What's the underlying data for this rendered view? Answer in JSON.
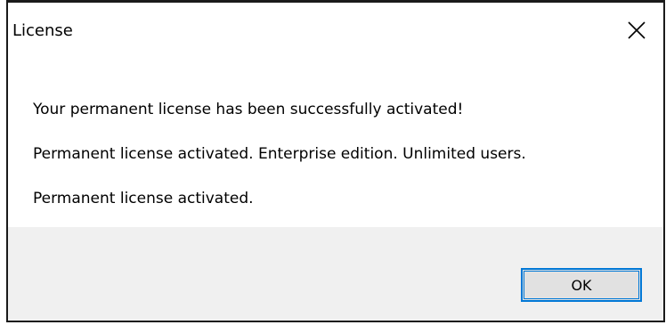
{
  "window": {
    "title": "License",
    "close_icon": "close-icon"
  },
  "messages": [
    "Your permanent license has been successfully activated!",
    "Permanent license activated. Enterprise edition. Unlimited users.",
    "Permanent license activated."
  ],
  "footer": {
    "ok_label": "OK"
  },
  "colors": {
    "accent": "#0078d7",
    "footer_bg": "#f0f0f0",
    "button_bg": "#e1e1e1",
    "border": "#1a1a1a"
  }
}
